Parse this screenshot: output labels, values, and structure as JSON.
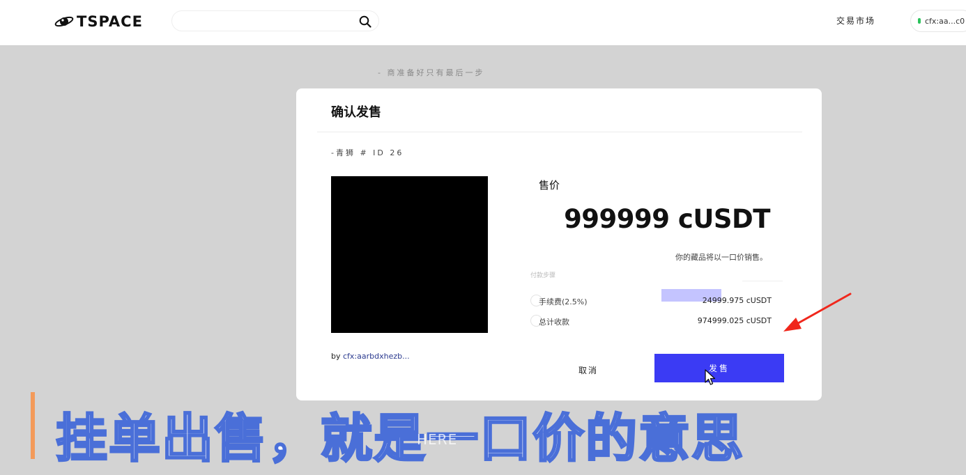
{
  "header": {
    "logo_text": "TSPACE",
    "search_placeholder": "",
    "nav_market": "交易市场",
    "wallet_address": "cfx:aa...c0"
  },
  "step_hint": "-  商准备好只有最后一步",
  "modal": {
    "title": "确认发售",
    "item_name": "-青狮  # ID 26",
    "owner_prefix": "by",
    "owner_address": "cfx:aarbdxhezb...",
    "price_label": "售价",
    "price_value": "999999 cUSDT",
    "fixed_price_note": "你的藏品将以一口价销售。",
    "payment_steps_label": "付款步骤",
    "fee": {
      "label": "手续费(2.5%)",
      "amount": "24999.975 cUSDT"
    },
    "total": {
      "label": "总计收款",
      "amount": "974999.025 cUSDT"
    },
    "cancel_label": "取消",
    "sell_label": "发售"
  },
  "subtitle": "挂单出售，就是一口价的意思",
  "watermark": "HERE",
  "colors": {
    "sell_button": "#3b3bf4",
    "subtitle_outline": "#4a6fd8",
    "annotation_arrow": "#f0271c",
    "subtitle_bar": "#f39a5a"
  }
}
